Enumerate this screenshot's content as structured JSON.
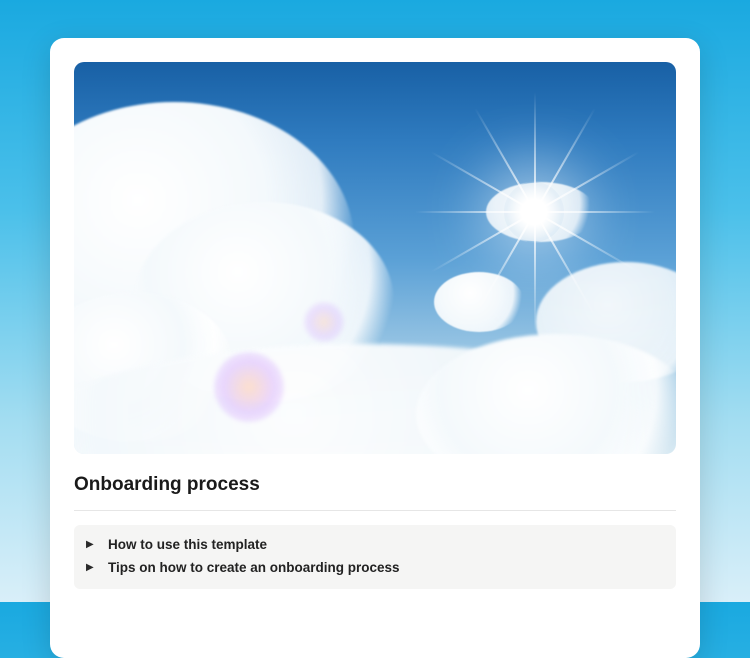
{
  "title": "Onboarding process",
  "toggles": [
    {
      "label": "How to use this template"
    },
    {
      "label": "Tips on how to create an onboarding process"
    }
  ]
}
